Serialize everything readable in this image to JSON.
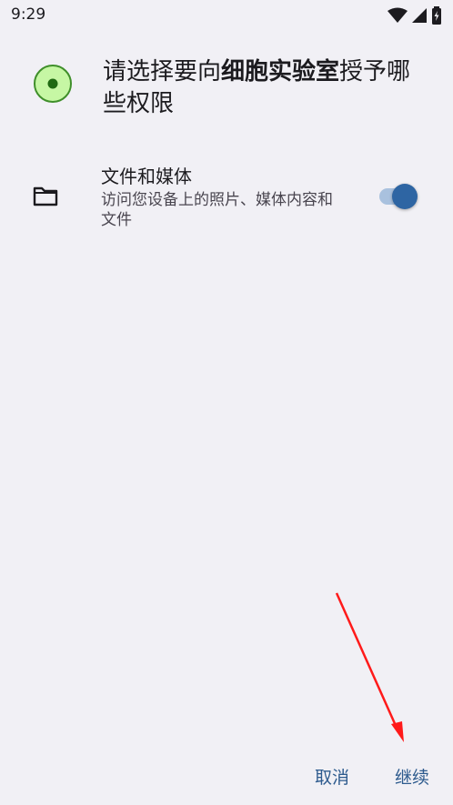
{
  "status_bar": {
    "time": "9:29"
  },
  "dialog": {
    "title_prefix": "请选择要向",
    "app_name": "细胞实验室",
    "title_suffix": "授予哪些权限"
  },
  "permissions": [
    {
      "title": "文件和媒体",
      "description": "访问您设备上的照片、媒体内容和文件",
      "enabled": true,
      "icon": "folder-icon"
    }
  ],
  "buttons": {
    "cancel": "取消",
    "continue": "继续"
  },
  "colors": {
    "accent": "#2e65a3",
    "button_text": "#2e5b8e",
    "annotation_arrow": "#ff1a1a"
  }
}
